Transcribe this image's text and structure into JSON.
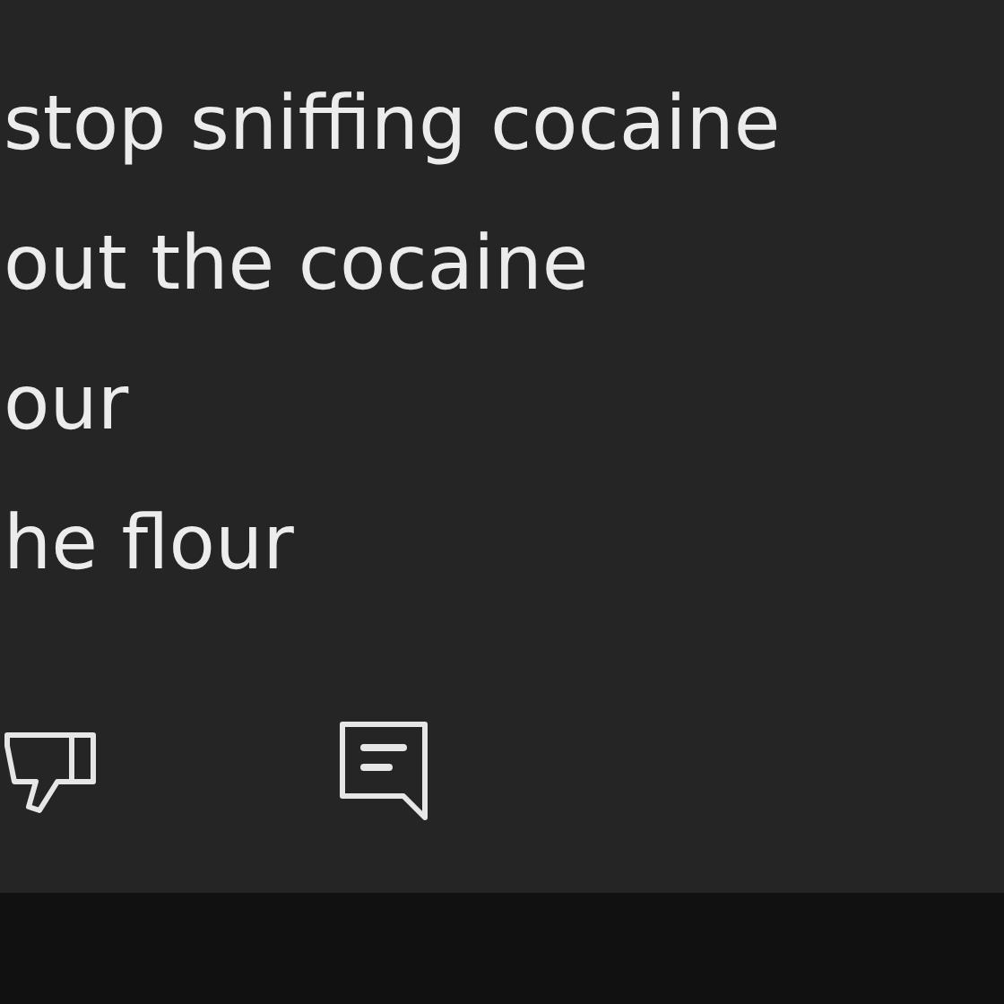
{
  "comment": {
    "lines": [
      "stop sniffing cocaine",
      "out the cocaine",
      "our",
      "he flour"
    ]
  },
  "actions": [
    {
      "kind": "dislike"
    },
    {
      "kind": "reply"
    }
  ]
}
